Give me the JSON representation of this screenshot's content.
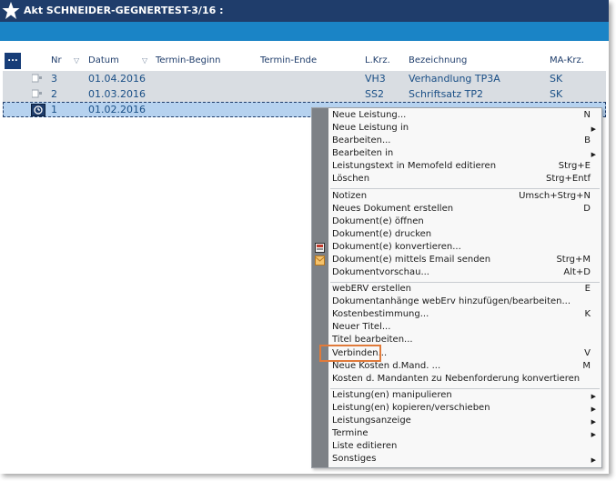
{
  "window": {
    "title": "Akt SCHNEIDER-GEGNERTEST-3/16 :"
  },
  "toolbar": {
    "ellipsis_label": "..."
  },
  "table": {
    "columns": [
      "Nr",
      "Datum",
      "Termin-Beginn",
      "Termin-Ende",
      "L.Krz.",
      "Bezeichnung",
      "MA-Krz."
    ],
    "rows": [
      {
        "nr": "3",
        "datum": "01.04.2016",
        "lkrz": "VH3",
        "bezeichnung": "Verhandlung TP3A",
        "ma": "SK"
      },
      {
        "nr": "2",
        "datum": "01.03.2016",
        "lkrz": "SS2",
        "bezeichnung": "Schriftsatz TP2",
        "ma": "SK"
      },
      {
        "nr": "1",
        "datum": "01.02.2016"
      }
    ]
  },
  "context_menu": {
    "items": [
      {
        "label": "Neue Leistung...",
        "shortcut": "N",
        "submenu": false
      },
      {
        "label": "Neue Leistung in",
        "shortcut": "",
        "submenu": true
      },
      {
        "label": "Bearbeiten...",
        "shortcut": "B",
        "submenu": false
      },
      {
        "label": "Bearbeiten in",
        "shortcut": "",
        "submenu": true
      },
      {
        "label": "Leistungstext in Memofeld editieren",
        "shortcut": "Strg+E",
        "submenu": false
      },
      {
        "label": "Löschen",
        "shortcut": "Strg+Entf",
        "submenu": false
      },
      {
        "label": "Notizen",
        "shortcut": "Umsch+Strg+N",
        "submenu": false
      },
      {
        "label": "Neues Dokument erstellen",
        "shortcut": "D",
        "submenu": false
      },
      {
        "label": "Dokument(e) öffnen",
        "shortcut": "",
        "submenu": false
      },
      {
        "label": "Dokument(e) drucken",
        "shortcut": "",
        "submenu": false
      },
      {
        "label": "Dokument(e) konvertieren...",
        "shortcut": "",
        "submenu": false
      },
      {
        "label": "Dokument(e) mittels Email senden",
        "shortcut": "Strg+M",
        "submenu": false
      },
      {
        "label": "Dokumentvorschau...",
        "shortcut": "Alt+D",
        "submenu": false
      },
      {
        "label": "webERV erstellen",
        "shortcut": "E",
        "submenu": false
      },
      {
        "label": "Dokumentanhänge webErv hinzufügen/bearbeiten...",
        "shortcut": "",
        "submenu": false
      },
      {
        "label": "Kostenbestimmung...",
        "shortcut": "K",
        "submenu": false
      },
      {
        "label": "Neuer Titel...",
        "shortcut": "",
        "submenu": false
      },
      {
        "label": "Titel bearbeiten...",
        "shortcut": "",
        "submenu": false
      },
      {
        "label": "Verbinden...",
        "shortcut": "V",
        "submenu": false
      },
      {
        "label": "Neue Kosten d.Mand. ...",
        "shortcut": "M",
        "submenu": false
      },
      {
        "label": "Kosten d. Mandanten zu Nebenforderung konvertieren",
        "shortcut": "",
        "submenu": false
      },
      {
        "label": "Leistung(en) manipulieren",
        "shortcut": "",
        "submenu": true
      },
      {
        "label": "Leistung(en) kopieren/verschieben",
        "shortcut": "",
        "submenu": true
      },
      {
        "label": "Leistungsanzeige",
        "shortcut": "",
        "submenu": true
      },
      {
        "label": "Termine",
        "shortcut": "",
        "submenu": true
      },
      {
        "label": "Liste editieren",
        "shortcut": "",
        "submenu": false
      },
      {
        "label": "Sonstiges",
        "shortcut": "",
        "submenu": true
      }
    ]
  },
  "colors": {
    "titlebar": "#1f3d6b",
    "accentbar": "#1a84c6",
    "selected_row": "#b6d2ef",
    "highlight_box": "#e07a3a"
  }
}
